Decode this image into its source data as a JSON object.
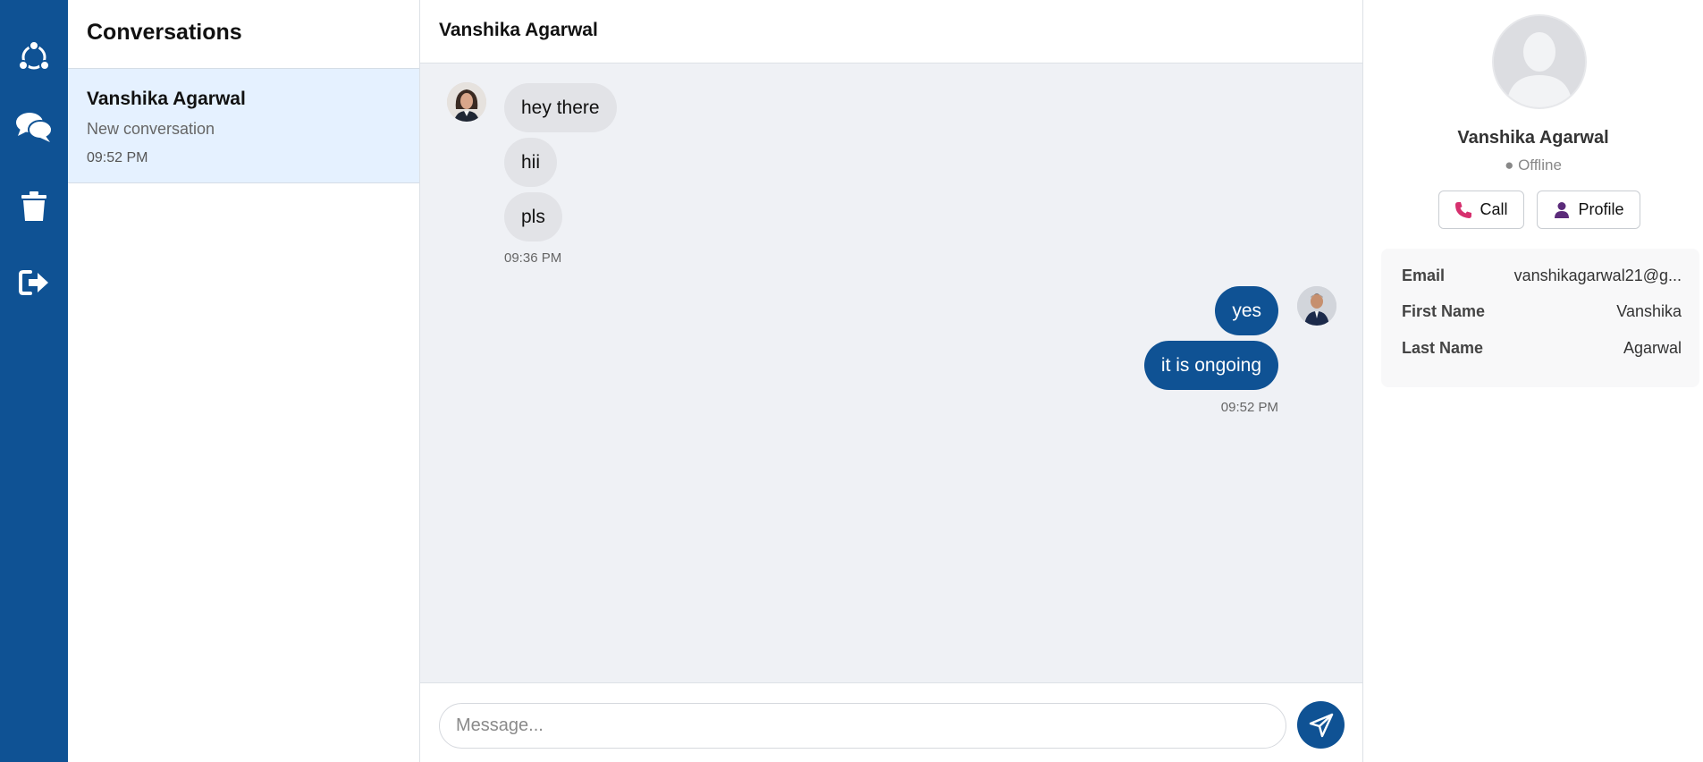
{
  "nav": {
    "items": [
      {
        "name": "network-icon"
      },
      {
        "name": "chat-bubbles-icon"
      },
      {
        "name": "trash-icon"
      },
      {
        "name": "logout-icon"
      }
    ]
  },
  "conversations": {
    "title": "Conversations",
    "items": [
      {
        "name": "Vanshika Agarwal",
        "preview": "New conversation",
        "time": "09:52 PM"
      }
    ]
  },
  "chat": {
    "header_name": "Vanshika Agarwal",
    "incoming": {
      "messages": [
        "hey there",
        "hii",
        "pls"
      ],
      "time": "09:36 PM"
    },
    "outgoing": {
      "messages": [
        "yes",
        "it is ongoing"
      ],
      "time": "09:52 PM"
    },
    "input_placeholder": "Message...",
    "input_value": ""
  },
  "profile": {
    "name": "Vanshika Agarwal",
    "status": "● Offline",
    "call_label": "Call",
    "profile_label": "Profile",
    "fields": {
      "email_label": "Email",
      "email_value": "vanshikagarwal21@g...",
      "first_name_label": "First Name",
      "first_name_value": "Vanshika",
      "last_name_label": "Last Name",
      "last_name_value": "Agarwal"
    }
  },
  "colors": {
    "primary": "#0f5294",
    "selected_row": "#e5f1ff",
    "chat_bg": "#eff1f5",
    "incoming_bubble": "#e2e3e7"
  }
}
